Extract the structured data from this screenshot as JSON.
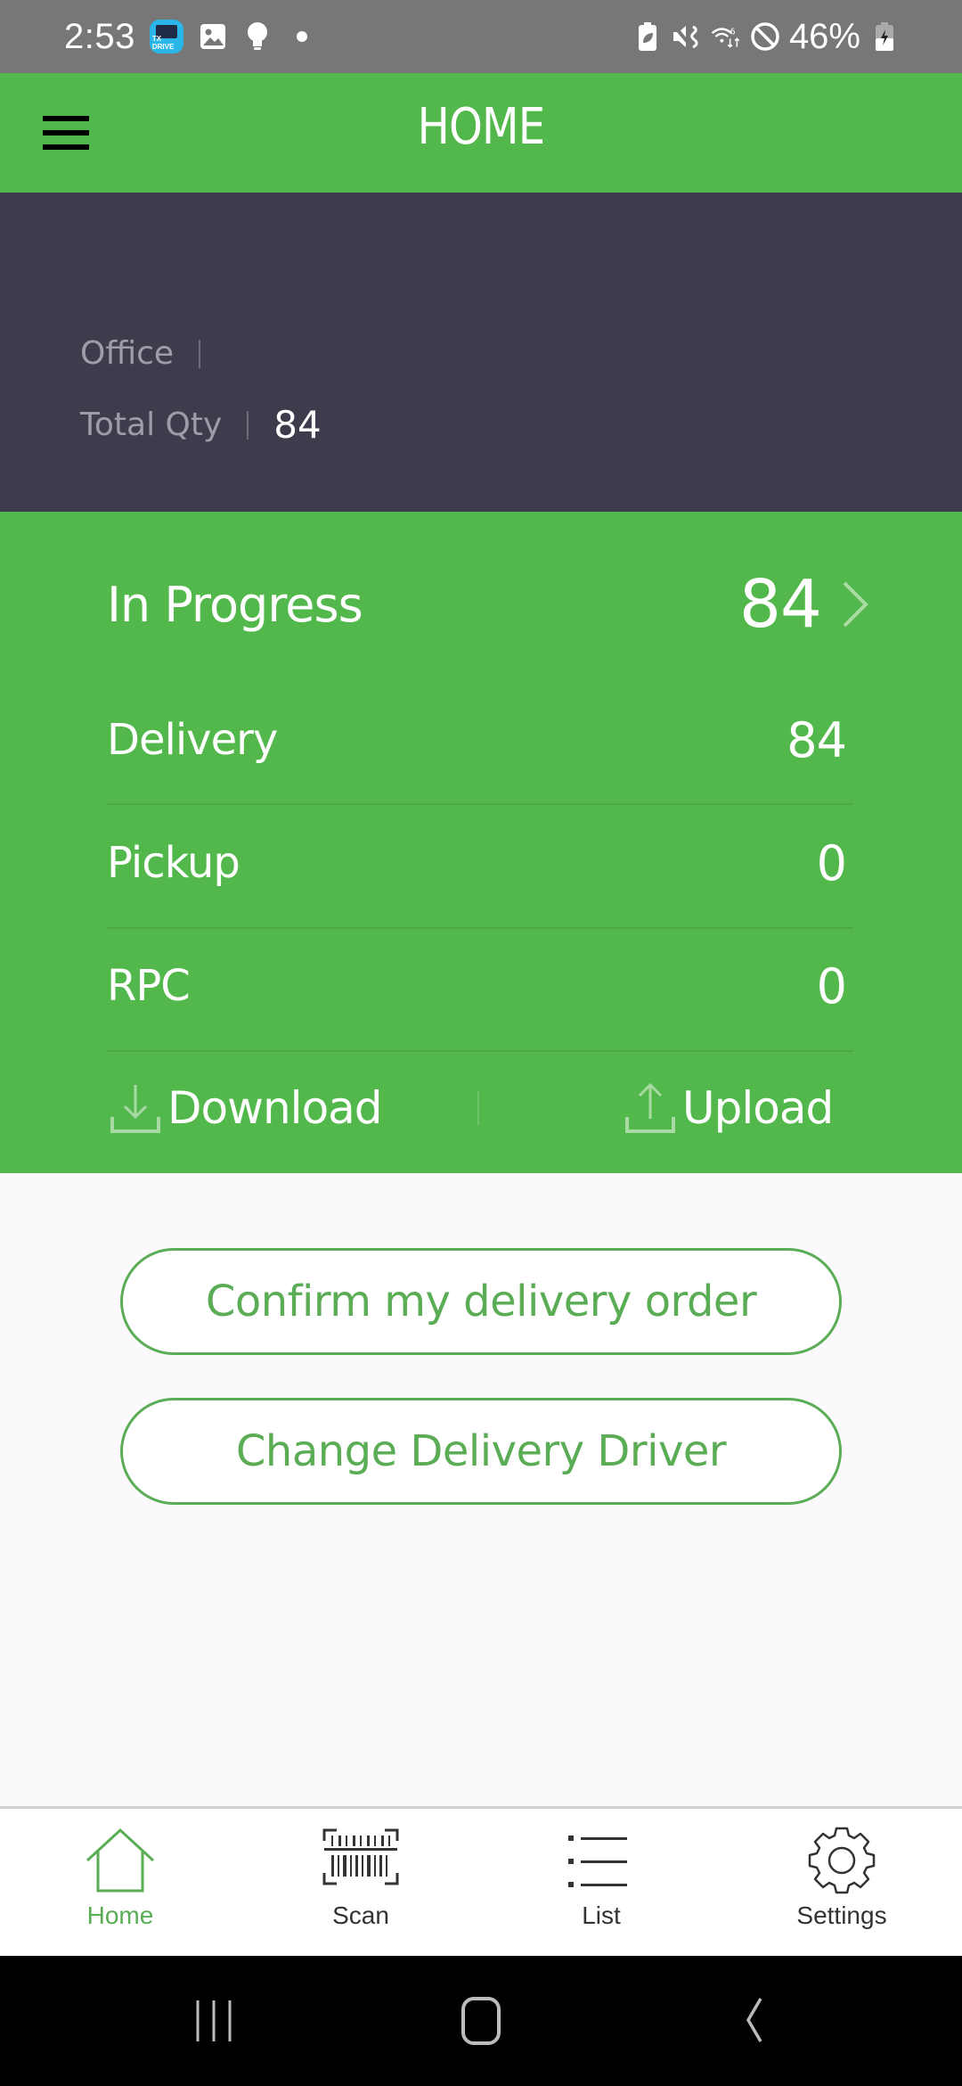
{
  "status_bar": {
    "time": "2:53",
    "app_badge_text": "TX DRIVE",
    "left_icons": [
      "tx-drive-app-icon",
      "gallery-icon",
      "lightbulb-icon",
      "dot-icon"
    ],
    "right_icons": [
      "battery-saver-icon",
      "vibrate-mute-icon",
      "wifi-6-icon",
      "do-not-disturb-icon",
      "battery-charging-icon"
    ],
    "battery_percent": "46%"
  },
  "header": {
    "title": "HOME",
    "menu_icon": "hamburger-menu-icon"
  },
  "summary": {
    "office_label": "Office",
    "office_value": "",
    "total_qty_label": "Total Qty",
    "total_qty_value": "84"
  },
  "stats": {
    "in_progress": {
      "label": "In Progress",
      "value": "84"
    },
    "rows": [
      {
        "label": "Delivery",
        "value": "84"
      },
      {
        "label": "Pickup",
        "value": "0"
      },
      {
        "label": "RPC",
        "value": "0"
      }
    ],
    "download_label": "Download",
    "upload_label": "Upload"
  },
  "buttons": {
    "confirm_order": "Confirm my delivery order",
    "change_driver": "Change Delivery Driver"
  },
  "tabs": [
    {
      "label": "Home",
      "icon": "home-icon",
      "active": true
    },
    {
      "label": "Scan",
      "icon": "barcode-scan-icon",
      "active": false
    },
    {
      "label": "List",
      "icon": "list-icon",
      "active": false
    },
    {
      "label": "Settings",
      "icon": "gear-icon",
      "active": false
    }
  ],
  "colors": {
    "primary_green": "#52b84b",
    "button_green": "#5aac55",
    "summary_bg": "#3d3c4c",
    "status_bar_bg": "#777777",
    "nav_bar_bg": "#000000"
  }
}
